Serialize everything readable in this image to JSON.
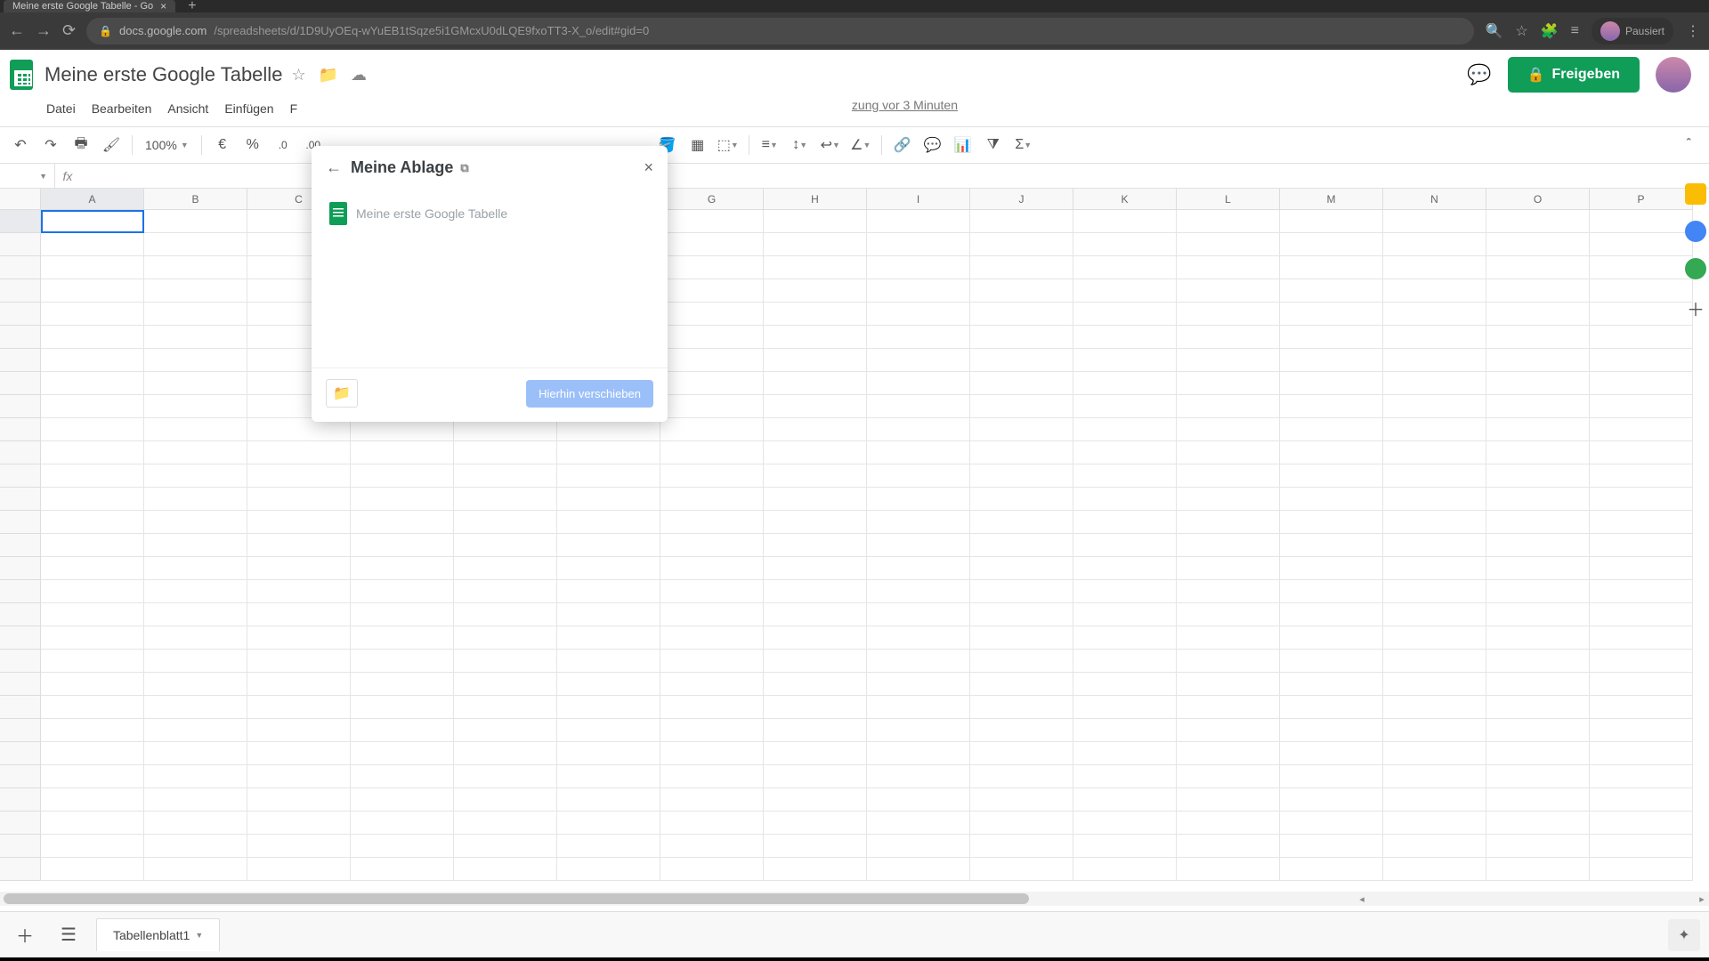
{
  "browser": {
    "tab_title": "Meine erste Google Tabelle - Go",
    "url_host": "docs.google.com",
    "url_path": "/spreadsheets/d/1D9UyOEq-wYuEB1tSqze5i1GMcxU0dLQE9fxoTT3-X_o/edit#gid=0",
    "paused_label": "Pausiert"
  },
  "doc": {
    "title": "Meine erste Google Tabelle",
    "last_edit": "zung vor 3 Minuten"
  },
  "menu": {
    "file": "Datei",
    "edit": "Bearbeiten",
    "view": "Ansicht",
    "insert": "Einfügen",
    "format_initial": "F"
  },
  "toolbar": {
    "zoom": "100%",
    "currency": "€",
    "percent": "%",
    "dec_dec": ".0",
    "dec_inc": ".00"
  },
  "share_label": "Freigeben",
  "columns": [
    "A",
    "B",
    "C",
    "",
    "",
    "",
    "G",
    "H",
    "I",
    "J",
    "K",
    "L",
    "M",
    "N",
    "O",
    "P"
  ],
  "active_cell_col": "A",
  "popover": {
    "title": "Meine Ablage",
    "file_name": "Meine erste Google Tabelle",
    "move_button": "Hierhin verschieben"
  },
  "sheet_tab": "Tabellenblatt1",
  "fx_label": "fx"
}
